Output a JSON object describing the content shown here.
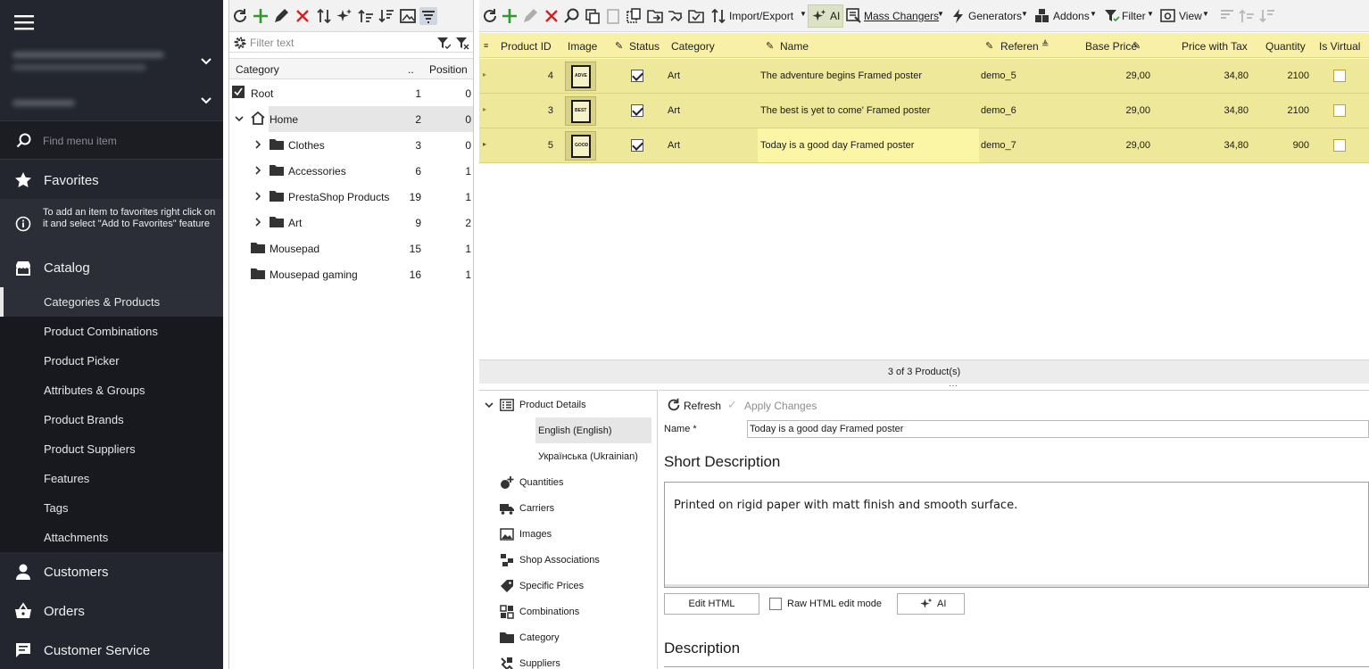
{
  "sidebar": {
    "search_placeholder": "Find menu item",
    "favorites_label": "Favorites",
    "favorites_note": "To add an item to favorites right click on it and select \"Add to Favorites\" feature",
    "catalog_label": "Catalog",
    "catalog_items": [
      "Categories & Products",
      "Product Combinations",
      "Product Picker",
      "Attributes & Groups",
      "Product Brands",
      "Product Suppliers",
      "Features",
      "Tags",
      "Attachments"
    ],
    "customers_label": "Customers",
    "orders_label": "Orders",
    "customer_service_label": "Customer Service"
  },
  "tree": {
    "filter_placeholder": "Filter text",
    "col_category": "Category",
    "col_count": "..",
    "col_position": "Position",
    "rows": [
      {
        "label": "Root",
        "count": "1",
        "pos": "0"
      },
      {
        "label": "Home",
        "count": "2",
        "pos": "0"
      },
      {
        "label": "Clothes",
        "count": "3",
        "pos": "0"
      },
      {
        "label": "Accessories",
        "count": "6",
        "pos": "1"
      },
      {
        "label": "PrestaShop Products",
        "count": "19",
        "pos": "1"
      },
      {
        "label": "Art",
        "count": "9",
        "pos": "2"
      },
      {
        "label": "Mousepad",
        "count": "15",
        "pos": "1"
      },
      {
        "label": "Mousepad gaming",
        "count": "16",
        "pos": "1"
      }
    ]
  },
  "toolbar": {
    "import_export": "Import/Export",
    "ai": "AI",
    "mass_changers": "Mass Changers",
    "generators": "Generators",
    "addons": "Addons",
    "filter": "Filter",
    "view": "View"
  },
  "grid": {
    "columns": [
      "Product ID",
      "Image",
      "Status",
      "Category",
      "Name",
      "Referen",
      "Base Price",
      "Price with Tax",
      "Quantity",
      "Is Virtual"
    ],
    "rows": [
      {
        "id": "4",
        "category": "Art",
        "name": "The adventure begins Framed poster",
        "ref": "demo_5",
        "base": "29,00",
        "tax": "34,80",
        "qty": "2100",
        "thumb": "ADVE"
      },
      {
        "id": "3",
        "category": "Art",
        "name": "The best is yet to come' Framed poster",
        "ref": "demo_6",
        "base": "29,00",
        "tax": "34,80",
        "qty": "2100",
        "thumb": "BEST"
      },
      {
        "id": "5",
        "category": "Art",
        "name": "Today is a good day Framed poster",
        "ref": "demo_7",
        "base": "29,00",
        "tax": "34,80",
        "qty": "900",
        "thumb": "GOOD"
      }
    ],
    "footer": "3 of 3 Product(s)"
  },
  "details": {
    "nav": {
      "product_details": "Product Details",
      "lang_en": "English (English)",
      "lang_uk": "Українська (Ukrainian)",
      "items": [
        "Quantities",
        "Carriers",
        "Images",
        "Shop Associations",
        "Specific Prices",
        "Combinations",
        "Category",
        "Suppliers"
      ]
    },
    "refresh": "Refresh",
    "apply_changes": "Apply Changes",
    "name_label": "Name *",
    "name_value": "Today is a good day Framed poster",
    "short_desc_title": "Short Description",
    "short_desc_text": "Printed on rigid paper with matt finish and smooth surface.",
    "edit_html": "Edit HTML",
    "raw_html": "Raw HTML edit mode",
    "ai_btn": "AI",
    "description_title": "Description"
  }
}
